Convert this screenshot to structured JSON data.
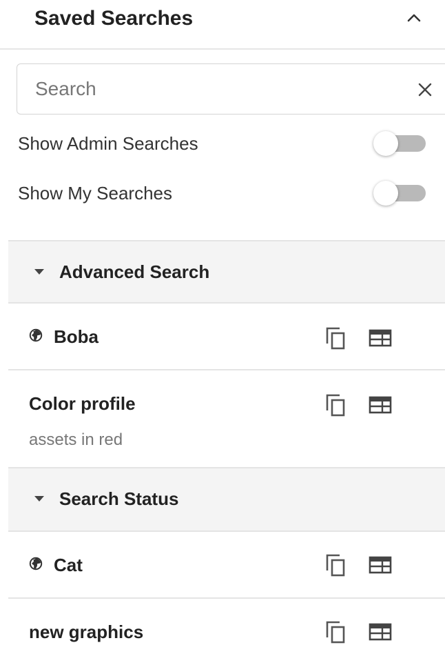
{
  "panel": {
    "title": "Saved Searches"
  },
  "search": {
    "placeholder": "Search",
    "value": ""
  },
  "toggles": [
    {
      "label": "Show Admin Searches",
      "on": false
    },
    {
      "label": "Show My Searches",
      "on": false
    }
  ],
  "groups": [
    {
      "title": "Advanced Search",
      "items": [
        {
          "title": "Boba",
          "description": "",
          "shared": true
        },
        {
          "title": "Color profile",
          "description": "assets in red",
          "shared": false
        }
      ]
    },
    {
      "title": "Search Status",
      "items": [
        {
          "title": "Cat",
          "description": "",
          "shared": true
        },
        {
          "title": "new graphics",
          "description": "",
          "shared": false
        }
      ]
    }
  ],
  "icons": {
    "collapse": "chevron-up-icon",
    "clear": "close-icon",
    "group_toggle": "caret-down-icon",
    "shared": "globe-icon",
    "duplicate": "copy-icon",
    "view": "panel-view-icon"
  },
  "colors": {
    "group_header_bg": "#f4f4f4",
    "switch_track_off": "#b9b9b9",
    "divider": "#e4e4e4",
    "text": "#222222",
    "muted_text": "#777777"
  }
}
